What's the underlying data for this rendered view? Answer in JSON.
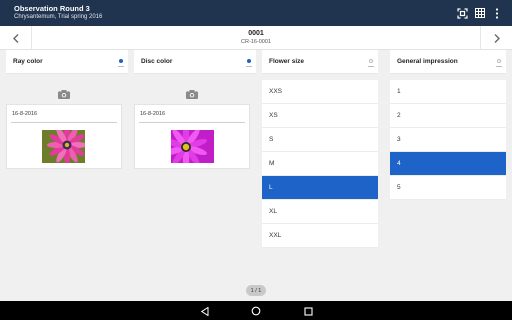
{
  "app_bar": {
    "title": "Observation Round 3",
    "subtitle": "Chrysantemum, Trial spring 2016",
    "actions": [
      "scan-icon",
      "grid-icon",
      "more-vert-icon"
    ],
    "background": "#20334f"
  },
  "record_nav": {
    "number": "0001",
    "code": "CR-16-0001",
    "prev_icon": "chevron-left-icon",
    "next_icon": "chevron-right-icon"
  },
  "columns": {
    "ray_color": {
      "label": "Ray color",
      "state": "filled",
      "card": {
        "date": "16-8-2016",
        "photo": "pink daisy flower"
      }
    },
    "disc_color": {
      "label": "Disc color",
      "state": "filled",
      "card": {
        "date": "16-8-2016",
        "photo": "magenta daisy flower"
      }
    },
    "flower_size": {
      "label": "Flower size",
      "state": "empty",
      "options": [
        "XXS",
        "XS",
        "S",
        "M",
        "L",
        "XL",
        "XXL"
      ],
      "selected": "L"
    },
    "general_impression": {
      "label": "General impression",
      "state": "empty",
      "options": [
        "1",
        "2",
        "3",
        "4",
        "5"
      ],
      "selected": "4"
    }
  },
  "pager": {
    "text": "1 / 1"
  },
  "colors": {
    "accent": "#1e63c7",
    "appbar": "#20334f"
  }
}
